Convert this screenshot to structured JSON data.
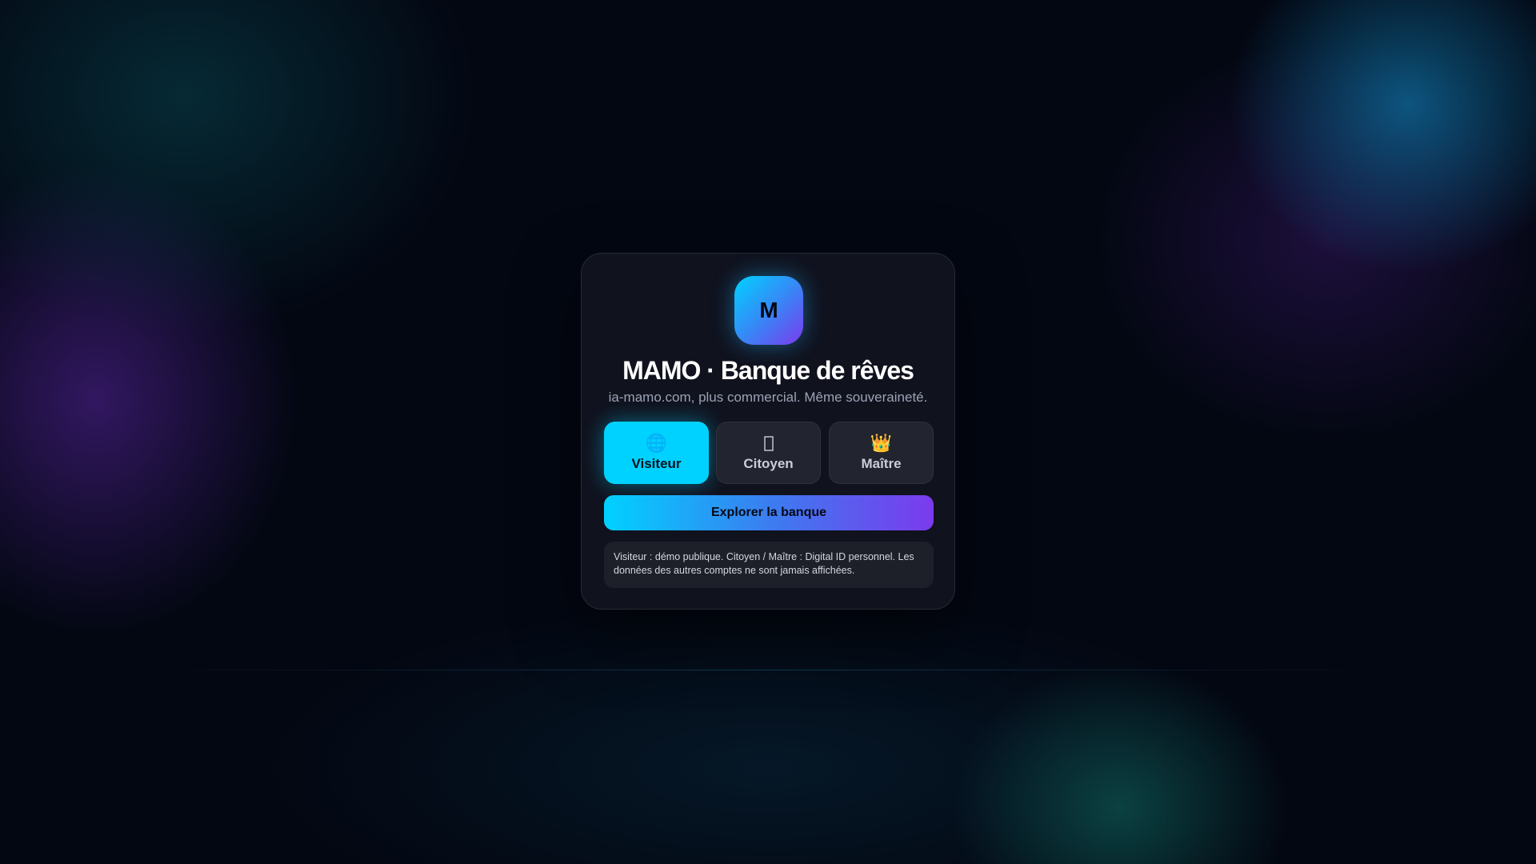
{
  "app": {
    "logo_letter": "M",
    "title": "MAMO · Banque de rêves",
    "subtitle": "ia-mamo.com, plus commercial. Même souveraineté."
  },
  "roles": [
    {
      "label": "Visiteur",
      "icon": "globe-icon",
      "glyph": "🌐",
      "selected": true
    },
    {
      "label": "Citoyen",
      "icon": "id-card-icon",
      "glyph": "",
      "selected": false
    },
    {
      "label": "Maître",
      "icon": "crown-icon",
      "glyph": "👑",
      "selected": false
    }
  ],
  "actions": {
    "explore_label": "Explorer la banque"
  },
  "info": {
    "note": "Visiteur : démo publique. Citoyen / Maître : Digital ID personnel. Les données des autres comptes ne sont jamais affichées."
  },
  "colors": {
    "accent_cyan": "#00d2ff",
    "accent_violet": "#7c3aed",
    "background": "#030712",
    "card": "#111420"
  }
}
